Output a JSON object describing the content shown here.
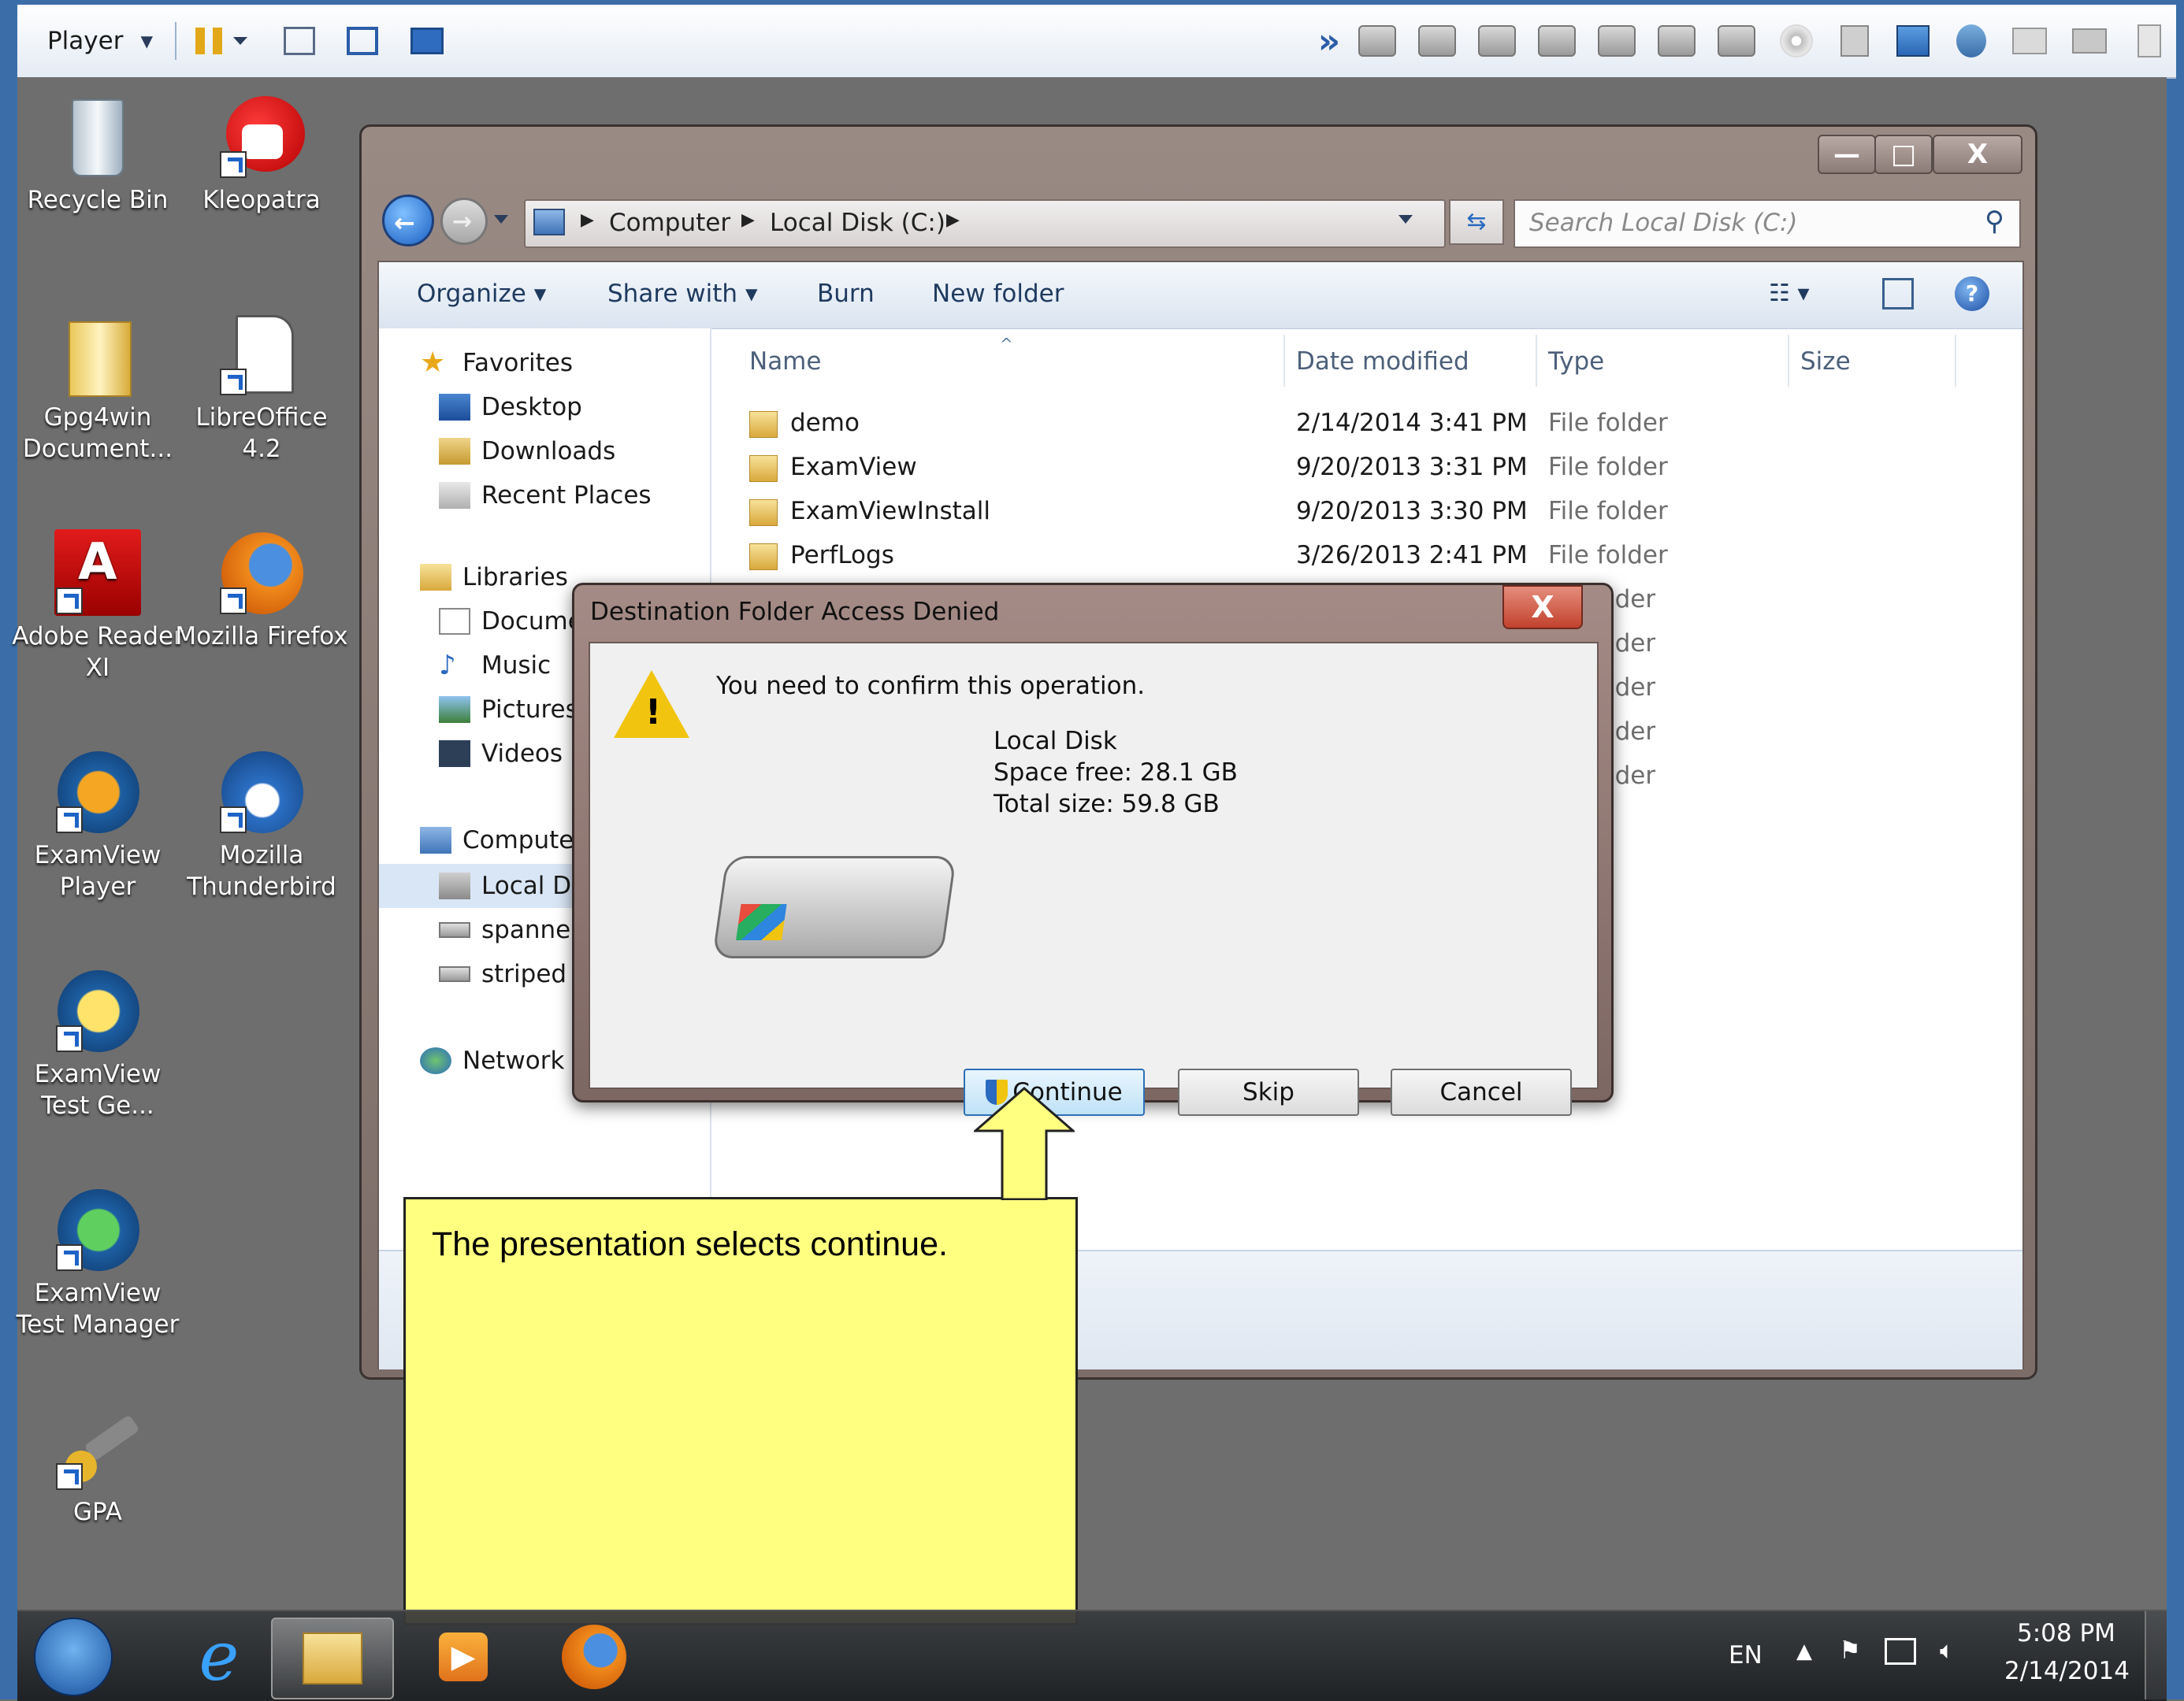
{
  "player": {
    "menu_label": "Player",
    "menu_arrow": "▾",
    "pause_icon": "pause-icon",
    "overflow": "»"
  },
  "desktop": {
    "icons": [
      {
        "label": "Recycle Bin",
        "icon": "recycle-bin-icon"
      },
      {
        "label": "Kleopatra",
        "icon": "kleopatra-icon"
      },
      {
        "label": "Gpg4win Document...",
        "icon": "folder-icon"
      },
      {
        "label": "LibreOffice 4.2",
        "icon": "libreoffice-icon"
      },
      {
        "label": "Adobe Reader XI",
        "icon": "adobe-reader-icon"
      },
      {
        "label": "Mozilla Firefox",
        "icon": "firefox-icon"
      },
      {
        "label": "ExamView Player",
        "icon": "examview-player-icon"
      },
      {
        "label": "Mozilla Thunderbird",
        "icon": "thunderbird-icon"
      },
      {
        "label": "ExamView Test Ge...",
        "icon": "examview-testgen-icon"
      },
      {
        "label": "ExamView Test Manager",
        "icon": "examview-testmanager-icon"
      },
      {
        "label": "GPA",
        "icon": "gpa-icon"
      }
    ]
  },
  "explorer": {
    "controls": {
      "minimize": "—",
      "maximize": "□",
      "close": "X"
    },
    "breadcrumb": [
      "Computer",
      "Local Disk (C:)"
    ],
    "search_placeholder": "Search Local Disk (C:)",
    "toolbar": {
      "organize": "Organize",
      "share_with": "Share with",
      "burn": "Burn",
      "new_folder": "New folder"
    },
    "nav": {
      "favorites": "Favorites",
      "desktop": "Desktop",
      "downloads": "Downloads",
      "recent_places": "Recent Places",
      "libraries": "Libraries",
      "documents": "Docume",
      "music": "Music",
      "pictures": "Pictures",
      "videos": "Videos",
      "computer": "Computer",
      "local_disk": "Local Di",
      "spanned": "spanned",
      "striped": "striped (",
      "network": "Network"
    },
    "columns": {
      "name": "Name",
      "date_modified": "Date modified",
      "type": "Type",
      "size": "Size"
    },
    "files": [
      {
        "name": "demo",
        "date": "2/14/2014 3:41 PM",
        "type": "File folder"
      },
      {
        "name": "ExamView",
        "date": "9/20/2013 3:31 PM",
        "type": "File folder"
      },
      {
        "name": "ExamViewInstall",
        "date": "9/20/2013 3:30 PM",
        "type": "File folder"
      },
      {
        "name": "PerfLogs",
        "date": "3/26/2013 2:41 PM",
        "type": "File folder"
      }
    ],
    "partial_type": "lder"
  },
  "dialog": {
    "title": "Destination Folder Access Denied",
    "close": "X",
    "message": "You need to confirm this operation.",
    "drive_name": "Local Disk",
    "space_free": "Space free: 28.1 GB",
    "total_size": "Total size: 59.8 GB",
    "buttons": {
      "continue": "Continue",
      "skip": "Skip",
      "cancel": "Cancel"
    }
  },
  "callout": {
    "text": "The presentation selects continue."
  },
  "taskbar": {
    "language": "EN",
    "time": "5:08 PM",
    "date": "2/14/2014"
  }
}
